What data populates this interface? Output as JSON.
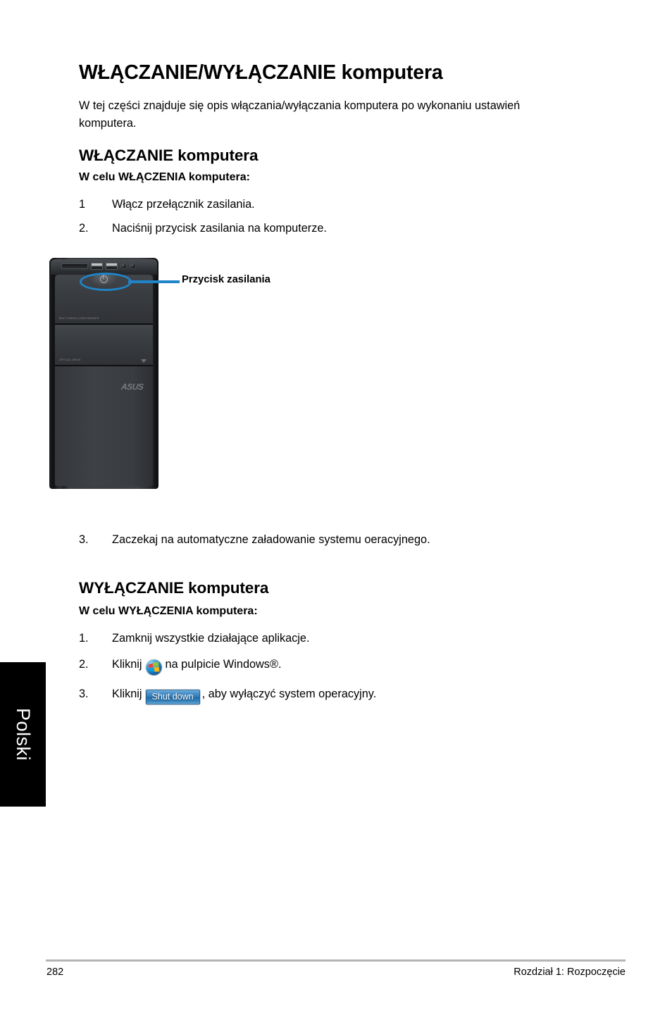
{
  "document": {
    "title": "WŁĄCZANIE/WYŁĄCZANIE komputera",
    "intro": "W tej części znajduje się opis włączania/wyłączania komputera po wykonaniu ustawień komputera."
  },
  "language_tab": {
    "label": "Polski"
  },
  "section_power_on": {
    "heading": "WŁĄCZANIE komputera",
    "subheading": "W celu WŁĄCZENIA komputera:",
    "steps": [
      {
        "num": "1",
        "text": "Włącz przełącznik zasilania."
      },
      {
        "num": "2.",
        "text": "Naciśnij przycisk zasilania na komputerze."
      },
      {
        "num": "3.",
        "text": "Zaczekaj na automatyczne załadowanie systemu oeracyjnego."
      }
    ]
  },
  "figure": {
    "callout_label": "Przycisk zasilania",
    "callout_color": "#1f85c8",
    "tower": {
      "brand": "ASUS",
      "bay_1_label": "MULTI-MEDIA CARD READER",
      "bay_2_label": "OPTICAL DRIVE"
    }
  },
  "section_power_off": {
    "heading": "WYŁĄCZANIE komputera",
    "subheading": "W celu WYŁĄCZENIA komputera:",
    "steps": [
      {
        "num": "1.",
        "text": "Zamknij wszystkie działające aplikacje."
      },
      {
        "num": "2.",
        "text_before": "Kliknij",
        "icon": "windows-start-orb-icon",
        "text_after": "na pulpicie Windows®."
      },
      {
        "num": "3.",
        "text_before": "Kliknij",
        "button_label": "Shut down",
        "text_after": ", aby wyłączyć system operacyjny."
      }
    ]
  },
  "footer": {
    "page_number": "282",
    "chapter": "Rozdział 1: Rozpoczęcie"
  }
}
